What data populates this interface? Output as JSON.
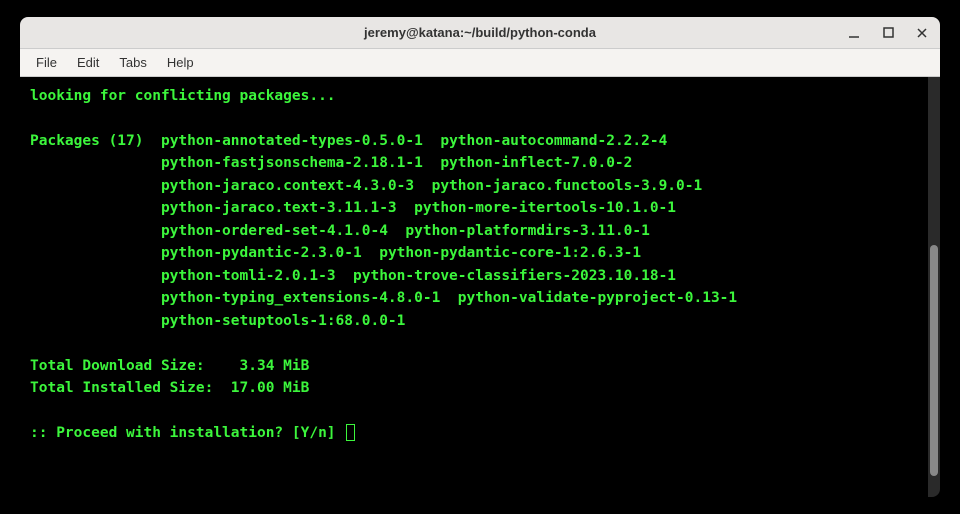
{
  "window": {
    "title": "jeremy@katana:~/build/python-conda"
  },
  "menu": {
    "file": "File",
    "edit": "Edit",
    "tabs": "Tabs",
    "help": "Help"
  },
  "terminal": {
    "looking": "looking for conflicting packages...",
    "packages_label": "Packages (17)",
    "package_count": 17,
    "packages": [
      "python-annotated-types-0.5.0-1",
      "python-autocommand-2.2.2-4",
      "python-fastjsonschema-2.18.1-1",
      "python-inflect-7.0.0-2",
      "python-jaraco.context-4.3.0-3",
      "python-jaraco.functools-3.9.0-1",
      "python-jaraco.text-3.11.1-3",
      "python-more-itertools-10.1.0-1",
      "python-ordered-set-4.1.0-4",
      "python-platformdirs-3.11.0-1",
      "python-pydantic-2.3.0-1",
      "python-pydantic-core-1:2.6.3-1",
      "python-tomli-2.0.1-3",
      "python-trove-classifiers-2023.10.18-1",
      "python-typing_extensions-4.8.0-1",
      "python-validate-pyproject-0.13-1",
      "python-setuptools-1:68.0.0-1"
    ],
    "download_label": "Total Download Size:",
    "download_value": "3.34 MiB",
    "installed_label": "Total Installed Size:",
    "installed_value": "17.00 MiB",
    "prompt": ":: Proceed with installation? [Y/n]"
  }
}
